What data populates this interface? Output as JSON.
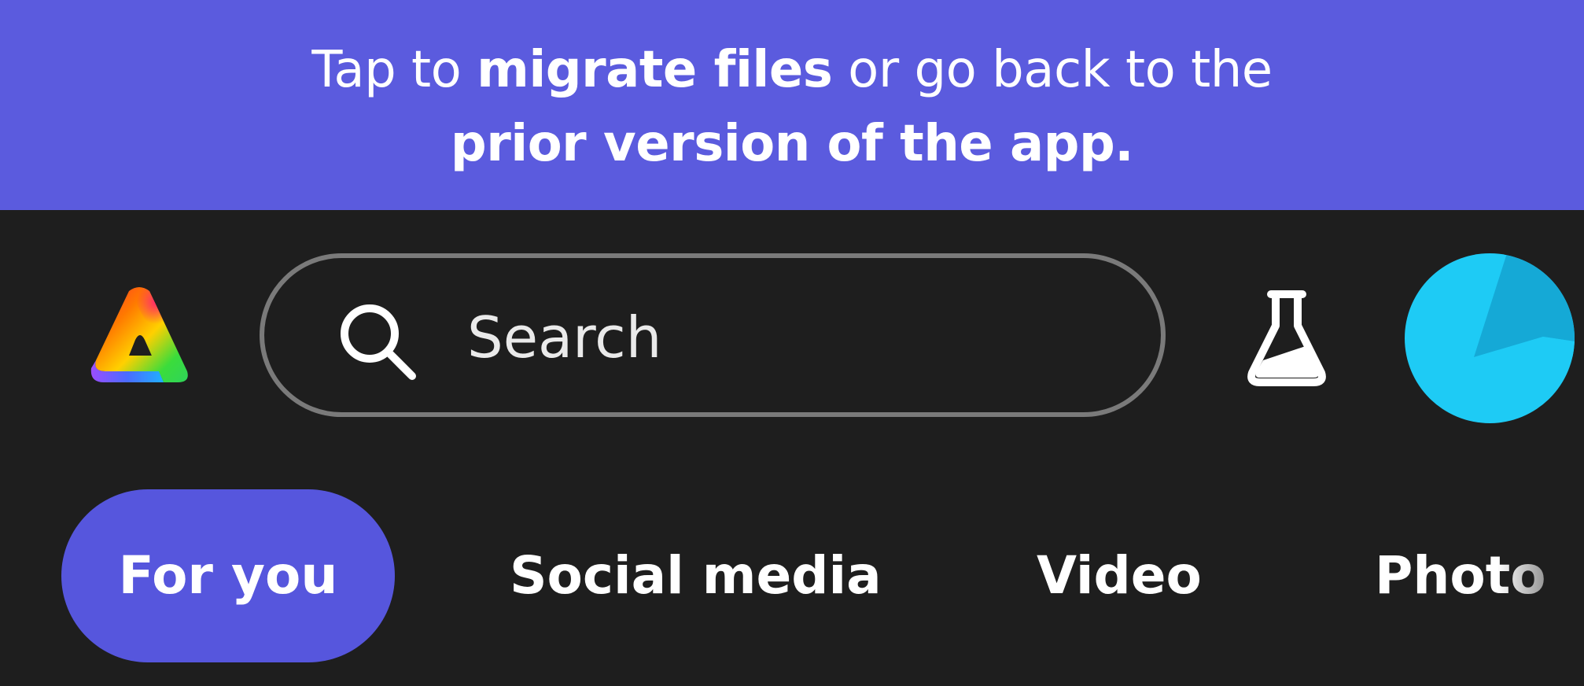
{
  "banner": {
    "line1_pre": "Tap to ",
    "line1_bold": "migrate files",
    "line1_post": " or go back to the",
    "line2_bold": "prior version of the app."
  },
  "header": {
    "logo_icon": "adobe-express-logo-icon",
    "search": {
      "icon": "search-icon",
      "placeholder": "Search"
    },
    "labs_icon": "flask-icon",
    "avatar_icon": "avatar"
  },
  "tabs": [
    {
      "label": "For you",
      "active": true
    },
    {
      "label": "Social media",
      "active": false
    },
    {
      "label": "Video",
      "active": false
    },
    {
      "label": "Photo",
      "active": false
    }
  ],
  "colors": {
    "banner": "#5b5bde",
    "accent": "#5656dd",
    "background": "#1e1e1e",
    "avatar": "#1ecbf5"
  }
}
